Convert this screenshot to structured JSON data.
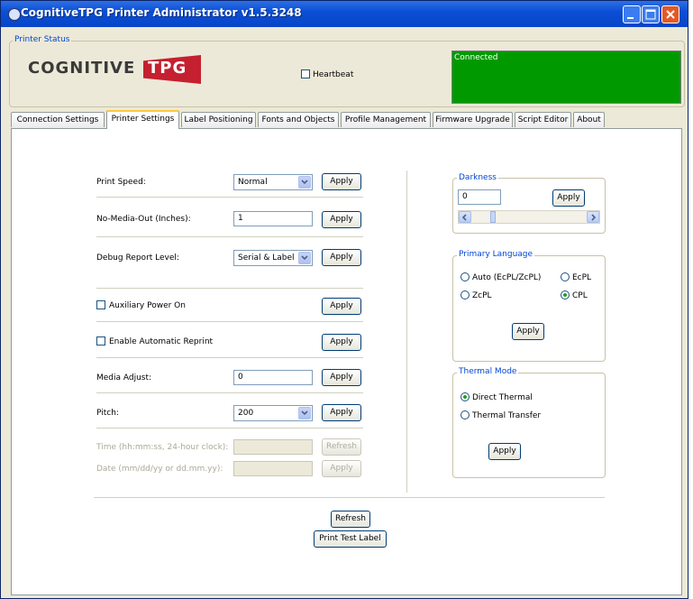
{
  "window": {
    "title": "CognitiveTPG Printer Administrator v1.5.3248"
  },
  "printer_status": {
    "legend": "Printer Status",
    "logo": "COGNITIVETPG",
    "heartbeat_label": "Heartbeat",
    "heartbeat_checked": false,
    "status_text": "Connected",
    "status_color": "#009a00"
  },
  "tabs": [
    {
      "label": "Connection Settings"
    },
    {
      "label": "Printer Settings",
      "active": true
    },
    {
      "label": "Label Positioning"
    },
    {
      "label": "Fonts and Objects"
    },
    {
      "label": "Profile Management"
    },
    {
      "label": "Firmware Upgrade"
    },
    {
      "label": "Script Editor"
    },
    {
      "label": "About"
    }
  ],
  "settings": {
    "print_speed": {
      "label": "Print Speed:",
      "value": "Normal",
      "button": "Apply"
    },
    "no_media_out": {
      "label": "No-Media-Out (Inches):",
      "value": "1",
      "button": "Apply"
    },
    "debug_report": {
      "label": "Debug Report Level:",
      "value": "Serial & Label",
      "button": "Apply"
    },
    "aux_power": {
      "label": "Auxiliary Power On",
      "checked": false,
      "button": "Apply"
    },
    "auto_reprint": {
      "label": "Enable Automatic Reprint",
      "checked": false,
      "button": "Apply"
    },
    "media_adjust": {
      "label": "Media Adjust:",
      "value": "0",
      "button": "Apply"
    },
    "pitch": {
      "label": "Pitch:",
      "value": "200",
      "button": "Apply"
    },
    "time": {
      "label": "Time (hh:mm:ss, 24-hour clock):",
      "value": "",
      "button": "Refresh"
    },
    "date": {
      "label": "Date (mm/dd/yy or dd.mm.yy):",
      "value": "",
      "button": "Apply"
    }
  },
  "darkness": {
    "legend": "Darkness",
    "value": "0",
    "button": "Apply",
    "level": 0
  },
  "primary_language": {
    "legend": "Primary Language",
    "options": [
      {
        "label": "Auto (EcPL/ZcPL)",
        "selected": false
      },
      {
        "label": "EcPL",
        "selected": false
      },
      {
        "label": "ZcPL",
        "selected": false
      },
      {
        "label": "CPL",
        "selected": true
      }
    ],
    "button": "Apply"
  },
  "thermal_mode": {
    "legend": "Thermal Mode",
    "options": [
      {
        "label": "Direct Thermal",
        "selected": true
      },
      {
        "label": "Thermal Transfer",
        "selected": false
      }
    ],
    "button": "Apply"
  },
  "footer": {
    "refresh": "Refresh",
    "print_test": "Print Test Label"
  }
}
